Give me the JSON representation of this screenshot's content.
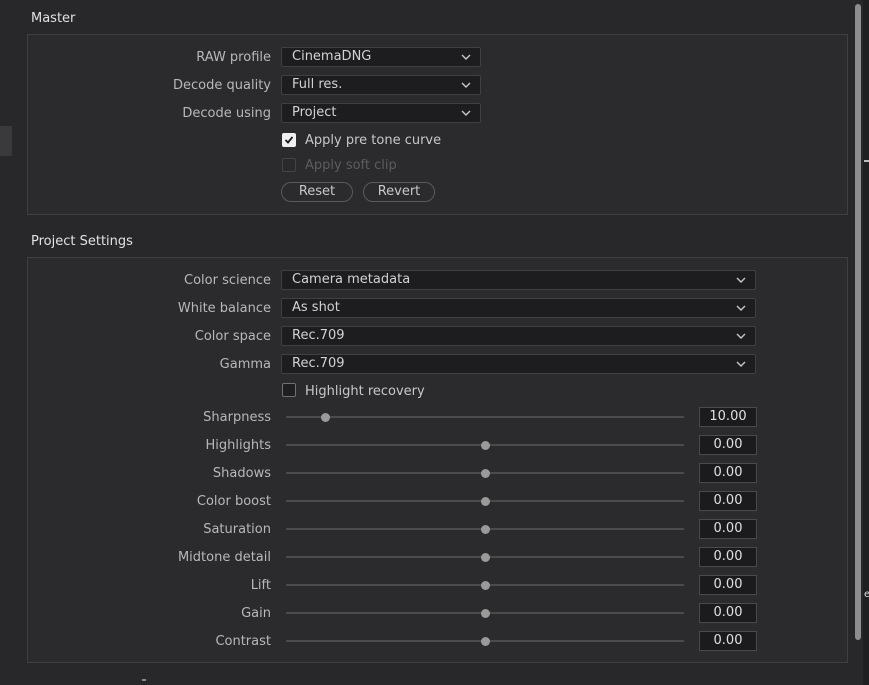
{
  "master": {
    "title": "Master",
    "raw_profile": {
      "label": "RAW profile",
      "value": "CinemaDNG"
    },
    "decode_quality": {
      "label": "Decode quality",
      "value": "Full res."
    },
    "decode_using": {
      "label": "Decode using",
      "value": "Project"
    },
    "apply_pre_tone_curve": {
      "label": "Apply pre tone curve",
      "checked": true
    },
    "apply_soft_clip": {
      "label": "Apply soft clip",
      "checked": false,
      "disabled": true
    },
    "reset_label": "Reset",
    "revert_label": "Revert"
  },
  "project": {
    "title": "Project Settings",
    "color_science": {
      "label": "Color science",
      "value": "Camera metadata"
    },
    "white_balance": {
      "label": "White balance",
      "value": "As shot"
    },
    "color_space": {
      "label": "Color space",
      "value": "Rec.709"
    },
    "gamma": {
      "label": "Gamma",
      "value": "Rec.709"
    },
    "highlight_recovery": {
      "label": "Highlight recovery",
      "checked": false
    },
    "sliders": [
      {
        "label": "Sharpness",
        "value": "10.00",
        "fraction": 0.1
      },
      {
        "label": "Highlights",
        "value": "0.00",
        "fraction": 0.5
      },
      {
        "label": "Shadows",
        "value": "0.00",
        "fraction": 0.5
      },
      {
        "label": "Color boost",
        "value": "0.00",
        "fraction": 0.5
      },
      {
        "label": "Saturation",
        "value": "0.00",
        "fraction": 0.5
      },
      {
        "label": "Midtone detail",
        "value": "0.00",
        "fraction": 0.5
      },
      {
        "label": "Lift",
        "value": "0.00",
        "fraction": 0.5
      },
      {
        "label": "Gain",
        "value": "0.00",
        "fraction": 0.5
      },
      {
        "label": "Contrast",
        "value": "0.00",
        "fraction": 0.5
      }
    ]
  },
  "edge": {
    "right_label": "e"
  }
}
